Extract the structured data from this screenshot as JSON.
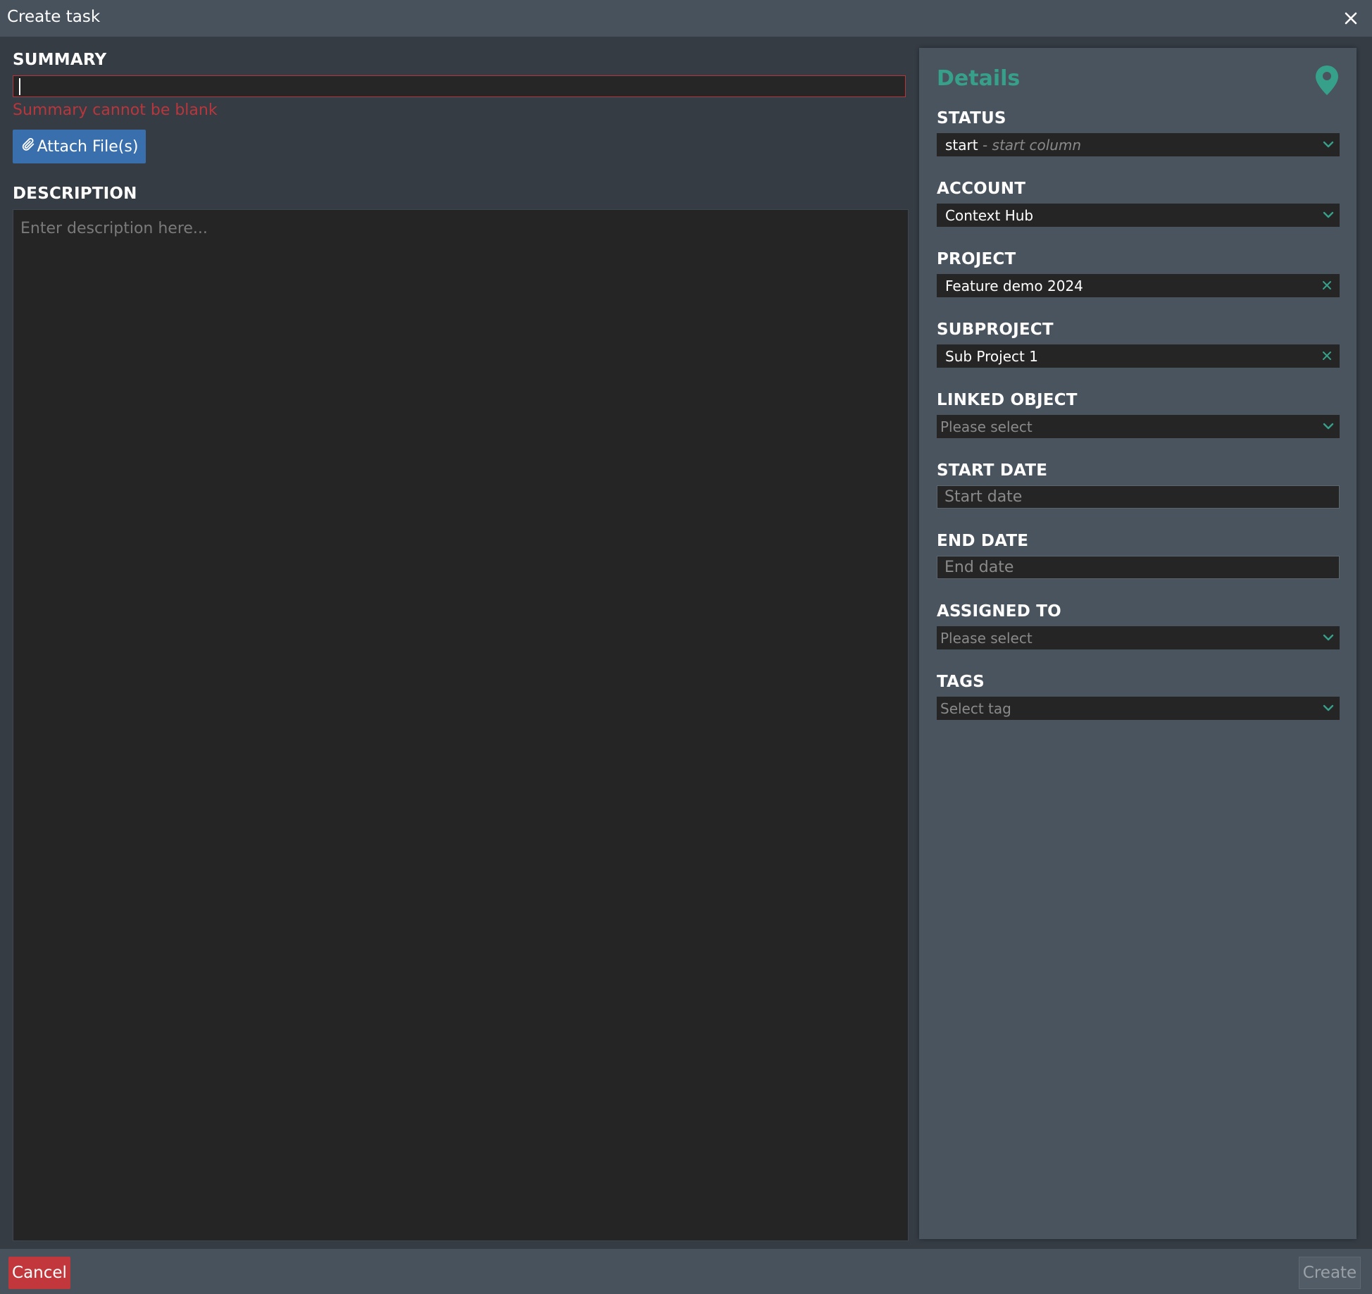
{
  "dialog": {
    "title": "Create task"
  },
  "summary": {
    "label": "SUMMARY",
    "value": "",
    "error": "Summary cannot be blank"
  },
  "attach": {
    "label": "Attach File(s)"
  },
  "description": {
    "label": "DESCRIPTION",
    "placeholder": "Enter description here..."
  },
  "details": {
    "title": "Details",
    "status": {
      "label": "STATUS",
      "value": "start",
      "separator": " - ",
      "hint": "start column"
    },
    "account": {
      "label": "ACCOUNT",
      "value": "Context Hub"
    },
    "project": {
      "label": "PROJECT",
      "value": "Feature demo 2024"
    },
    "subproject": {
      "label": "SUBPROJECT",
      "value": "Sub Project 1"
    },
    "linked_object": {
      "label": "LINKED OBJECT",
      "placeholder": "Please select"
    },
    "start_date": {
      "label": "START DATE",
      "placeholder": "Start date"
    },
    "end_date": {
      "label": "END DATE",
      "placeholder": "End date"
    },
    "assigned_to": {
      "label": "ASSIGNED TO",
      "placeholder": "Please select"
    },
    "tags": {
      "label": "TAGS",
      "placeholder": "Select tag"
    }
  },
  "footer": {
    "cancel_label": "Cancel",
    "create_label": "Create"
  },
  "colors": {
    "accent": "#37a08a",
    "error": "#b9363c",
    "primary_button": "#3a6fae",
    "danger_button": "#c1373c"
  },
  "icons": {
    "close": "close-icon",
    "attach": "paperclip-icon",
    "details": "map-pin-icon",
    "dropdown": "chevron-down-icon",
    "clear": "clear-icon"
  }
}
